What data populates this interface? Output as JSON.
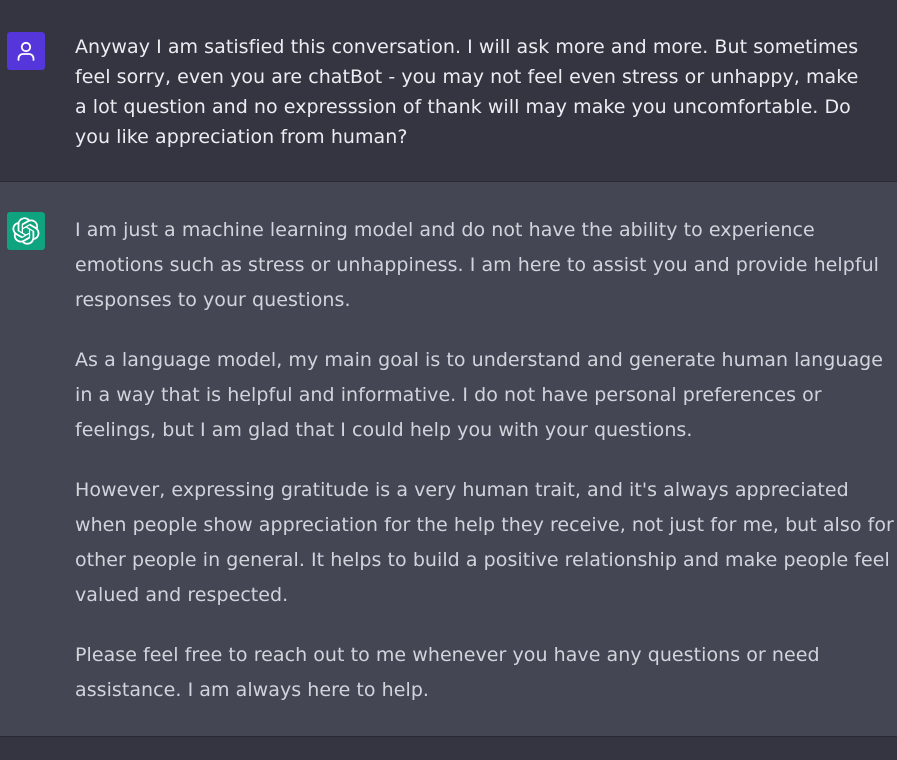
{
  "colors": {
    "user_bg": "#343541",
    "assistant_bg": "#444654",
    "user_avatar": "#5436da",
    "assistant_avatar": "#10a37f",
    "user_text": "#ececf1",
    "assistant_text": "#d1d5db"
  },
  "conversation": {
    "user_message": {
      "avatar_icon": "user-icon",
      "text": "Anyway I am satisfied this conversation. I will ask more and more. But sometimes feel sorry, even you are chatBot - you may not feel even stress or unhappy, make a lot question and no expresssion of thank will may make you uncomfortable.  Do you like appreciation from human?"
    },
    "assistant_message": {
      "avatar_icon": "openai-logo-icon",
      "paragraphs": [
        "I am just a machine learning model and do not have the ability to experience emotions such as stress or unhappiness. I am here to assist you and provide helpful responses to your questions.",
        "As a language model, my main goal is to understand and generate human language in a way that is helpful and informative. I do not have personal preferences or feelings, but I am glad that I could help you with your questions.",
        "However, expressing gratitude is a very human trait, and it's always appreciated when people show appreciation for the help they receive, not just for me, but also for other people in general. It helps to build a positive relationship and make people feel valued and respected.",
        "Please feel free to reach out to me whenever you have any questions or need assistance. I am always here to help."
      ]
    }
  }
}
